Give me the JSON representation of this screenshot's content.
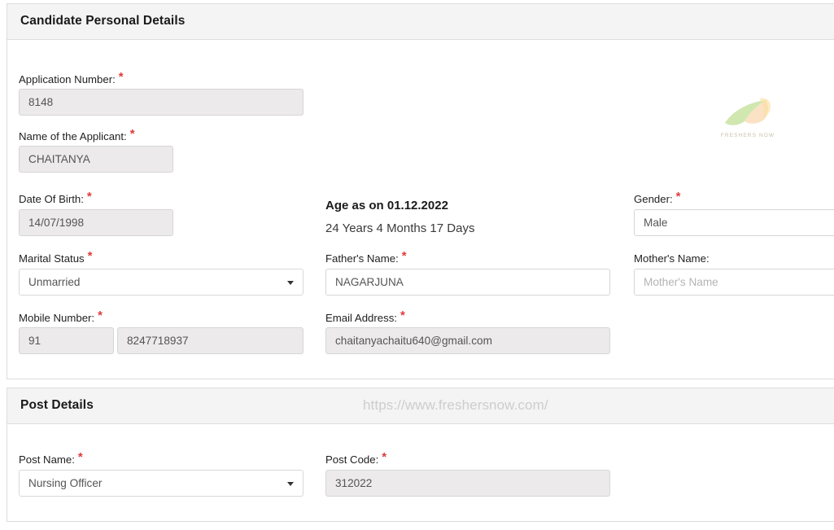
{
  "sections": {
    "personal": {
      "title": "Candidate Personal Details",
      "fields": {
        "application_number": {
          "label": "Application Number:",
          "value": "8148",
          "required": true
        },
        "applicant_name": {
          "label": "Name of the Applicant:",
          "value": "CHAITANYA",
          "required": true
        },
        "date_of_birth": {
          "label": "Date Of Birth:",
          "value": "14/07/1998",
          "required": true
        },
        "marital_status": {
          "label": "Marital Status",
          "value": "Unmarried",
          "required": true
        },
        "mobile_code": {
          "label": "Mobile Number:",
          "value": "91",
          "required": true
        },
        "mobile_number": {
          "value": "8247718937"
        },
        "fathers_name": {
          "label": "Father's Name:",
          "value": "NAGARJUNA",
          "required": true
        },
        "email_address": {
          "label": "Email Address:",
          "value": "chaitanyachaitu640@gmail.com",
          "required": true
        },
        "gender": {
          "label": "Gender:",
          "value": "Male",
          "required": true
        },
        "mothers_name": {
          "label": "Mother's Name:",
          "value": "",
          "placeholder": "Mother's Name",
          "required": false
        }
      },
      "age_block": {
        "title": "Age as on 01.12.2022",
        "value": "24 Years 4 Months 17 Days"
      }
    },
    "post": {
      "title": "Post Details",
      "watermark": "https://www.freshersnow.com/",
      "fields": {
        "post_name": {
          "label": "Post Name:",
          "value": "Nursing Officer",
          "required": true
        },
        "post_code": {
          "label": "Post Code:",
          "value": "312022",
          "required": true
        }
      }
    }
  },
  "logo": {
    "text": "FRESHERS NOW"
  },
  "colors": {
    "required_asterisk": "#e03a3a",
    "panel_header_bg": "#f4f4f4",
    "disabled_input_bg": "#eceaea",
    "watermark": "#cdcdcd"
  }
}
